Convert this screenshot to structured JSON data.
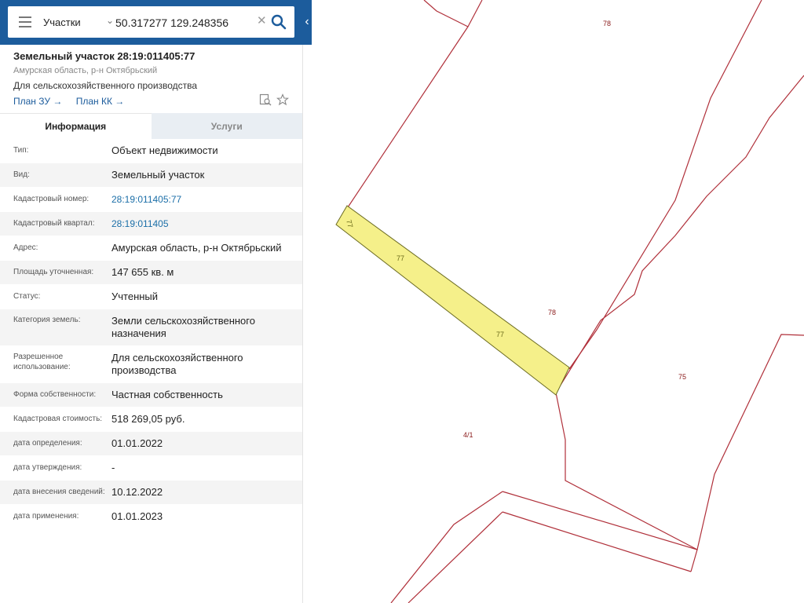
{
  "colors": {
    "header_bg": "#1c5c9c",
    "link": "#1c6fa8",
    "parcel_line": "#b0303a",
    "parcel_fill_selected": "#f5f08a"
  },
  "search": {
    "layer": "Участки",
    "query": "50.317277 129.248356"
  },
  "object": {
    "title": "Земельный участок 28:19:011405:77",
    "region": "Амурская область, р-н Октябрьский",
    "use": "Для сельскохозяйственного производства",
    "links": [
      "План ЗУ →",
      "План КК →"
    ]
  },
  "tabs": [
    {
      "label": "Информация",
      "active": true
    },
    {
      "label": "Услуги",
      "active": false
    }
  ],
  "properties": [
    {
      "label": "Тип:",
      "value": "Объект недвижимости"
    },
    {
      "label": "Вид:",
      "value": "Земельный участок"
    },
    {
      "label": "Кадастровый номер:",
      "value": "28:19:011405:77"
    },
    {
      "label": "Кадастровый квартал:",
      "value": "28:19:011405"
    },
    {
      "label": "Адрес:",
      "value": "Амурская область, р-н Октябрьский"
    },
    {
      "label": "Площадь уточненная:",
      "value": "147 655 кв. м"
    },
    {
      "label": "Статус:",
      "value": "Учтенный"
    },
    {
      "label": "Категория земель:",
      "value": "Земли сельскохозяйственного назначения"
    },
    {
      "label": "Разрешенное использование:",
      "value": "Для сельскохозяйственного производства"
    },
    {
      "label": "Форма собственности:",
      "value": "Частная собственность"
    },
    {
      "label": "Кадастровая стоимость:",
      "value": "518 269,05 руб."
    },
    {
      "label": "дата определения:",
      "value": "01.01.2022"
    },
    {
      "label": "дата утверждения:",
      "value": "-"
    },
    {
      "label": "дата внесения сведений:",
      "value": "10.12.2022"
    },
    {
      "label": "дата применения:",
      "value": "01.01.2023"
    }
  ],
  "map": {
    "labels": [
      "78",
      "77",
      "77",
      "77",
      "78",
      "75",
      "4/1"
    ]
  },
  "icons": {
    "menu": "menu-icon",
    "dropdown": "chevron-down-icon",
    "clear": "close-icon",
    "search": "search-icon",
    "collapse": "chevron-left-icon",
    "view": "search-document-icon",
    "favorite": "star-icon"
  }
}
